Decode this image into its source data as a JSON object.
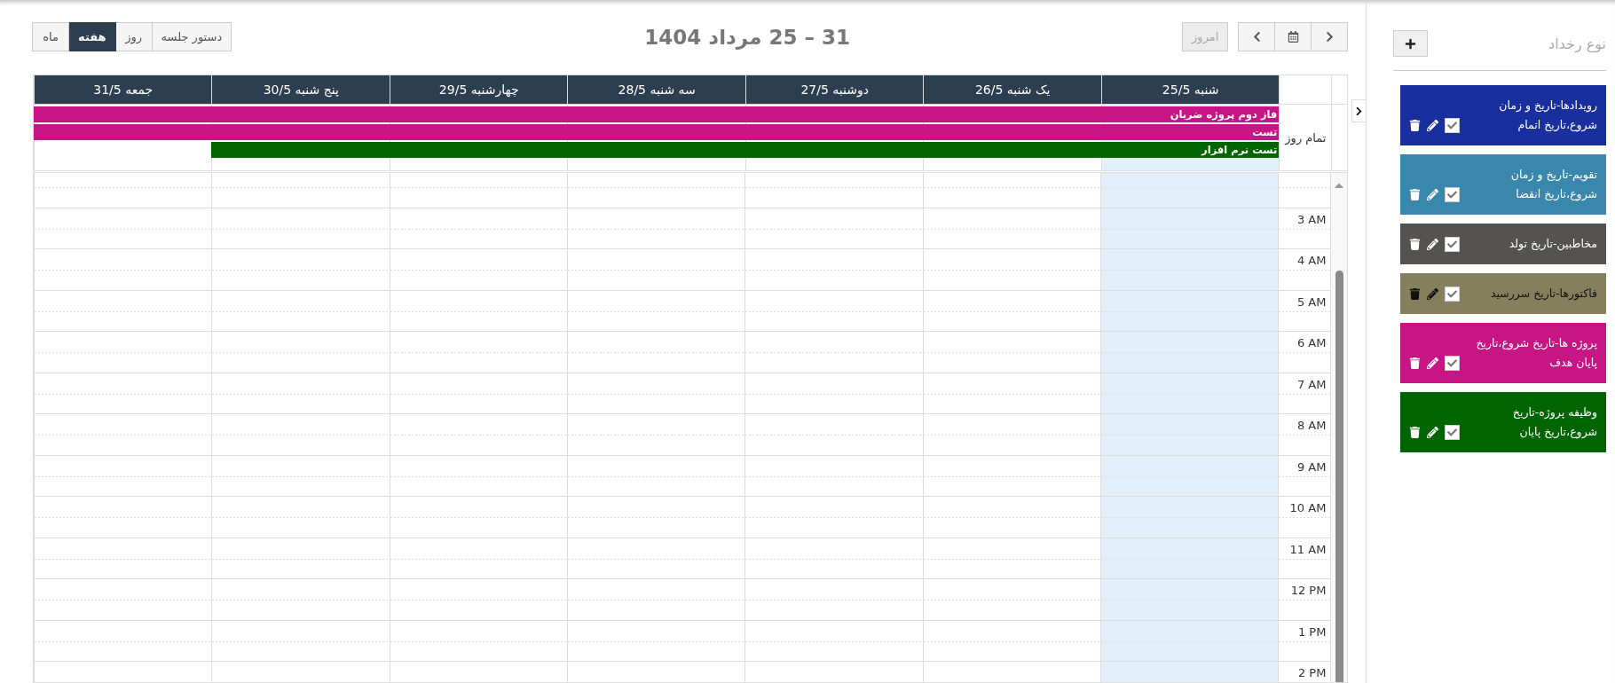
{
  "toolbar": {
    "today_button": {
      "label": "امروز",
      "disabled": true
    },
    "title": "31 – 25 مرداد 1404",
    "views": [
      {
        "label": "دستور جلسه",
        "selected": false
      },
      {
        "label": "روز",
        "selected": false
      },
      {
        "label": "هفته",
        "selected": true
      },
      {
        "label": "ماه",
        "selected": false
      }
    ]
  },
  "calendar": {
    "days": [
      {
        "label": "شنبه 25/5",
        "today": true
      },
      {
        "label": "یک شنبه 26/5",
        "today": false
      },
      {
        "label": "دوشنبه 27/5",
        "today": false
      },
      {
        "label": "سه شنبه 28/5",
        "today": false
      },
      {
        "label": "چهارشنبه 29/5",
        "today": false
      },
      {
        "label": "پنج شنبه 30/5",
        "today": false
      },
      {
        "label": "جمعه 31/5",
        "today": false
      }
    ],
    "all_day_label": "تمام روز",
    "all_day_events": [
      {
        "title": "فاز دوم پروژه ضربان",
        "color": "#c71585",
        "covers": [
          true,
          true,
          true,
          true,
          true,
          true,
          true
        ]
      },
      {
        "title": "تست",
        "color": "#c71585",
        "covers": [
          true,
          true,
          true,
          true,
          true,
          true,
          true
        ]
      },
      {
        "title": "تست نرم افزار",
        "color": "#006400",
        "covers": [
          true,
          true,
          true,
          true,
          true,
          true,
          false
        ]
      }
    ],
    "hours": [
      "3 AM",
      "4 AM",
      "5 AM",
      "6 AM",
      "7 AM",
      "8 AM",
      "9 AM",
      "10 AM",
      "11 AM",
      "12 PM",
      "1 PM",
      "2 PM"
    ]
  },
  "sidebar": {
    "title": "نوع رخداد",
    "event_types": [
      {
        "label": "رویدادها-تاریخ و زمان شروع،تاریخ اتمام",
        "color": "#1a2f9e",
        "checked": true,
        "dark_text": false
      },
      {
        "label": "تقویم-تاریخ و زمان شروع،تاریخ انقضا",
        "color": "#3a87ad",
        "checked": true,
        "dark_text": false
      },
      {
        "label": "مخاطبین-تاریخ تولد",
        "color": "#555252",
        "checked": true,
        "dark_text": false
      },
      {
        "label": "فاکتورها-تاریخ سررسید",
        "color": "#857f5e",
        "checked": true,
        "dark_text": true
      },
      {
        "label": "پروژه ها-تاریخ شروع،تاریخ پایان هدف",
        "color": "#c71585",
        "checked": true,
        "dark_text": false
      },
      {
        "label": "وظیفه پروژه-تاریخ شروع،تاریخ پایان",
        "color": "#006400",
        "checked": true,
        "dark_text": false
      }
    ]
  }
}
